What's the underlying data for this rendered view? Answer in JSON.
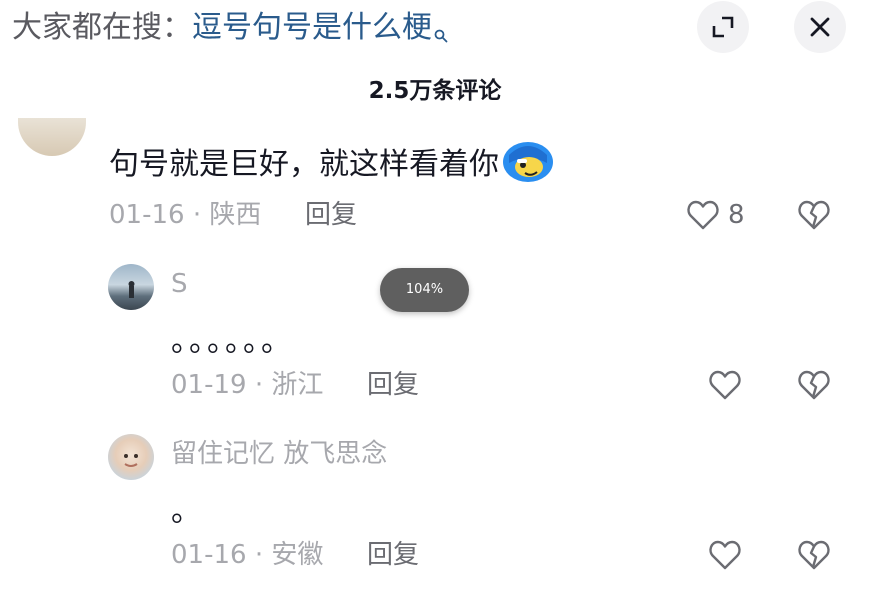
{
  "search_hint": {
    "prefix": "大家都在搜：",
    "query": "逗号句号是什么梗"
  },
  "header": {
    "comment_count": "2.5万条评论"
  },
  "zoom_indicator": "104%",
  "comments": [
    {
      "text": "句号就是巨好，就这样看着你",
      "date": "01-16",
      "location": "陕西",
      "reply_label": "回复",
      "likes": "8"
    },
    {
      "username": "S",
      "text": "。。。。。。",
      "date": "01-19",
      "location": "浙江",
      "reply_label": "回复"
    },
    {
      "username": "留住记忆  放飞思念",
      "text": "。",
      "date": "01-16",
      "location": "安徽",
      "reply_label": "回复"
    }
  ],
  "meta_separator": " · ",
  "colors": {
    "query_link": "#2a5b8c",
    "muted_text": "#a7a8ad",
    "reply_text": "#6b6c72"
  }
}
